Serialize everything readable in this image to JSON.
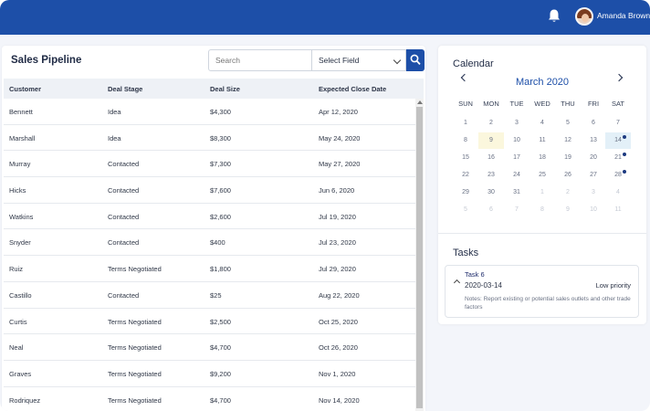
{
  "header": {
    "user_name": "Amanda Brown",
    "notification_icon": "bell-icon",
    "brand_color": "#1d4fa8"
  },
  "pipeline": {
    "title": "Sales Pipeline",
    "search_placeholder": "Search",
    "select_value": "Select Field",
    "columns": [
      "Customer",
      "Deal Stage",
      "Deal Size",
      "Expected Close Date"
    ],
    "rows": [
      [
        "Bennett",
        "Idea",
        "$4,300",
        "Apr 12, 2020"
      ],
      [
        "Marshall",
        "Idea",
        "$8,300",
        "May 24, 2020"
      ],
      [
        "Murray",
        "Contacted",
        "$7,300",
        "May 27, 2020"
      ],
      [
        "Hicks",
        "Contacted",
        "$7,600",
        "Jun 6, 2020"
      ],
      [
        "Watkins",
        "Contacted",
        "$2,600",
        "Jul 19, 2020"
      ],
      [
        "Snyder",
        "Contacted",
        "$400",
        "Jul 23, 2020"
      ],
      [
        "Ruiz",
        "Terms Negotiated",
        "$1,800",
        "Jul 29, 2020"
      ],
      [
        "Castillo",
        "Contacted",
        "$25",
        "Aug 22, 2020"
      ],
      [
        "Curtis",
        "Terms Negotiated",
        "$2,500",
        "Oct 25, 2020"
      ],
      [
        "Neal",
        "Terms Negotiated",
        "$4,700",
        "Oct 26, 2020"
      ],
      [
        "Graves",
        "Terms Negotiated",
        "$9,200",
        "Nov 1, 2020"
      ],
      [
        "Rodriquez",
        "Terms Negotiated",
        "$4,700",
        "Nov 14, 2020"
      ]
    ]
  },
  "calendar": {
    "title": "Calendar",
    "month": "March 2020",
    "weekdays": [
      "SUN",
      "MON",
      "TUE",
      "WED",
      "THU",
      "FRI",
      "SAT"
    ],
    "weeks": [
      [
        "1",
        "2",
        "3",
        "4",
        "5",
        "6",
        "7"
      ],
      [
        "8",
        "9",
        "10",
        "11",
        "12",
        "13",
        "14"
      ],
      [
        "15",
        "16",
        "17",
        "18",
        "19",
        "20",
        "21"
      ],
      [
        "22",
        "23",
        "24",
        "25",
        "26",
        "27",
        "28"
      ],
      [
        "29",
        "30",
        "31",
        "1",
        "2",
        "3",
        "4"
      ],
      [
        "5",
        "6",
        "7",
        "8",
        "9",
        "10",
        "11"
      ]
    ],
    "today": "9",
    "selected": "14",
    "days_with_events": [
      "14",
      "21",
      "28"
    ]
  },
  "tasks": {
    "title": "Tasks",
    "items": [
      {
        "name": "Task 6",
        "date": "2020-03-14",
        "priority": "Low priority",
        "notes": "Notes: Report existing or potential sales outlets and other trade factors"
      }
    ]
  }
}
